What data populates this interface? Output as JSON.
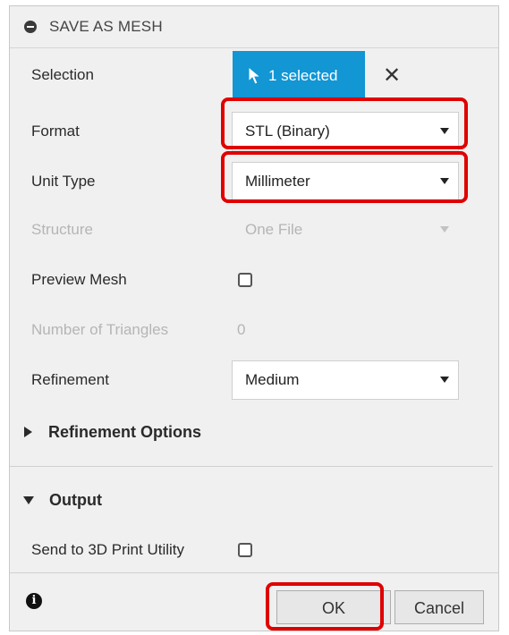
{
  "dialog": {
    "title": "SAVE AS MESH"
  },
  "selection": {
    "label": "Selection",
    "button_text": "1 selected",
    "clear": "✕"
  },
  "format": {
    "label": "Format",
    "value": "STL (Binary)"
  },
  "unit_type": {
    "label": "Unit Type",
    "value": "Millimeter"
  },
  "structure": {
    "label": "Structure",
    "value": "One File"
  },
  "preview_mesh": {
    "label": "Preview Mesh",
    "checked": false
  },
  "triangles": {
    "label": "Number of Triangles",
    "value": "0"
  },
  "refinement": {
    "label": "Refinement",
    "value": "Medium"
  },
  "refinement_options": {
    "label": "Refinement Options"
  },
  "output": {
    "label": "Output",
    "send_label": "Send to 3D Print Utility",
    "send_checked": false
  },
  "footer": {
    "info_glyph": "i",
    "ok_label": "OK",
    "cancel_label": "Cancel"
  },
  "colors": {
    "accent": "#1296d4",
    "highlight": "#e00000"
  }
}
